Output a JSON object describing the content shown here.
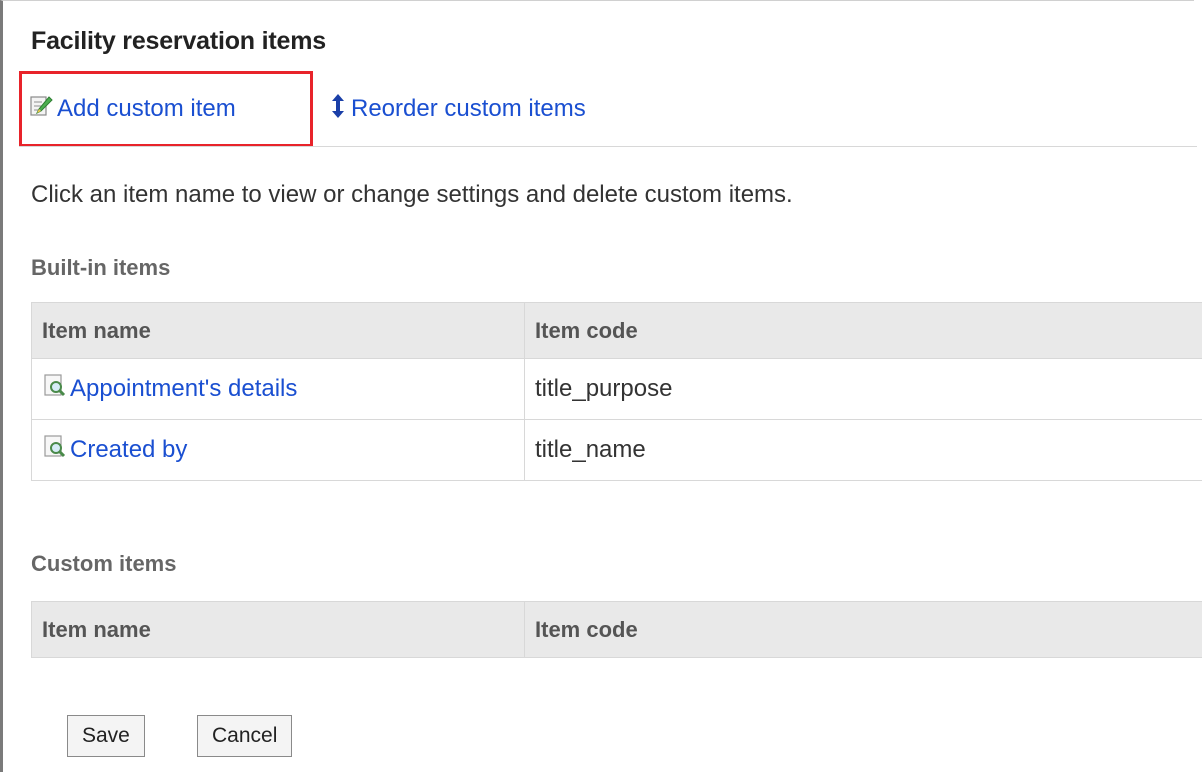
{
  "header": {
    "title": "Facility reservation items"
  },
  "menu": {
    "add_label": "Add custom item",
    "reorder_label": "Reorder custom items"
  },
  "description": "Click an item name to view or change settings and delete custom items.",
  "builtin": {
    "heading": "Built-in items",
    "columns": [
      "Item name",
      "Item code"
    ],
    "rows": [
      {
        "name": "Appointment's details",
        "code": "title_purpose"
      },
      {
        "name": "Created by",
        "code": "title_name"
      }
    ]
  },
  "custom": {
    "heading": "Custom items",
    "columns": [
      "Item name",
      "Item code"
    ]
  },
  "buttons": {
    "save": "Save",
    "cancel": "Cancel"
  },
  "colors": {
    "link": "#1a4fd1",
    "highlight": "#e8232a",
    "header_bg": "#e9e9e9"
  },
  "icons": {
    "add": "edit-pencil-icon",
    "reorder": "up-down-arrow-icon",
    "view": "magnifier-document-icon"
  }
}
